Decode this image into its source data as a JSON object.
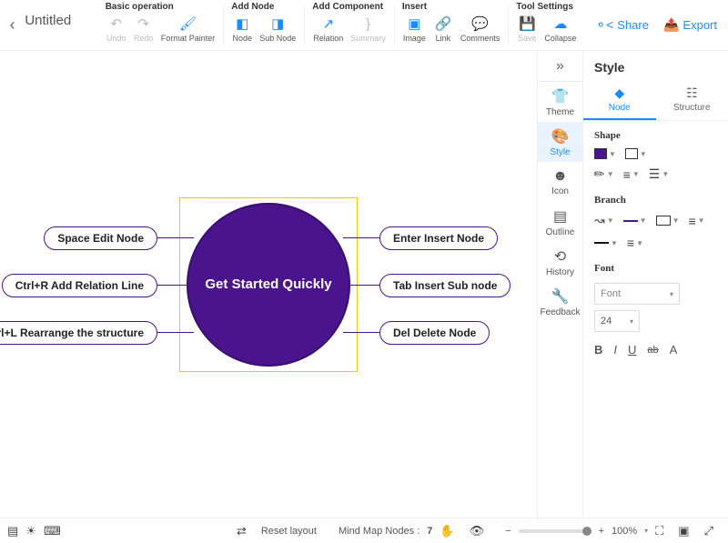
{
  "title": "Untitled",
  "toolbar_groups": {
    "basic": {
      "header": "Basic operation",
      "undo": "Undo",
      "redo": "Redo",
      "format_painter": "Format Painter"
    },
    "add_node": {
      "header": "Add Node",
      "node": "Node",
      "sub_node": "Sub Node"
    },
    "add_component": {
      "header": "Add Component",
      "relation": "Relation",
      "summary": "Summary"
    },
    "insert": {
      "header": "Insert",
      "image": "Image",
      "link": "Link",
      "comments": "Comments"
    },
    "tool_settings": {
      "header": "Tool Settings",
      "save": "Save",
      "collapse": "Collapse"
    }
  },
  "toolbar_right": {
    "share": "Share",
    "export": "Export"
  },
  "canvas": {
    "center": "Get Started Quickly",
    "leaves": {
      "space_edit": "Space Edit Node",
      "ctrl_r": "Ctrl+R Add Relation Line",
      "ctrl_l": "Ctrl+L Rearrange the structure",
      "enter_insert": "Enter Insert Node",
      "tab_insert": "Tab Insert Sub node",
      "del_delete": "Del Delete Node"
    }
  },
  "rail1": {
    "theme": "Theme",
    "style": "Style",
    "icon": "Icon",
    "outline": "Outline",
    "history": "History",
    "feedback": "Feedback"
  },
  "panel": {
    "title": "Style",
    "tabs": {
      "node": "Node",
      "structure": "Structure"
    },
    "sections": {
      "shape": "Shape",
      "branch": "Branch",
      "font": "Font"
    },
    "font_name": "Font",
    "font_size": "24"
  },
  "status": {
    "reset_layout": "Reset layout",
    "nodes_label": "Mind Map Nodes :",
    "nodes_count": "7",
    "zoom": "100%"
  },
  "colors": {
    "accent": "#1b8cff",
    "node": "#4a148c",
    "selection": "#f5c518"
  }
}
